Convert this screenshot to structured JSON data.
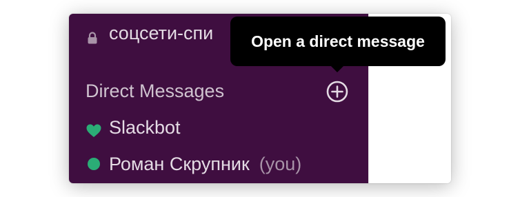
{
  "sidebar": {
    "channel": {
      "icon": "lock-icon",
      "label": "соцсети-спи"
    },
    "direct_messages": {
      "header_label": "Direct Messages",
      "add_button_icon": "plus-circle-icon",
      "items": [
        {
          "label": "Slackbot",
          "icon": "heart-icon",
          "icon_color": "#2bac76"
        },
        {
          "label": "Роман Скрупник",
          "suffix": "(you)",
          "icon": "presence-dot",
          "icon_color": "#2bac76"
        }
      ]
    },
    "background_color": "#3f0e40"
  },
  "tooltip": {
    "text": "Open a direct message"
  }
}
